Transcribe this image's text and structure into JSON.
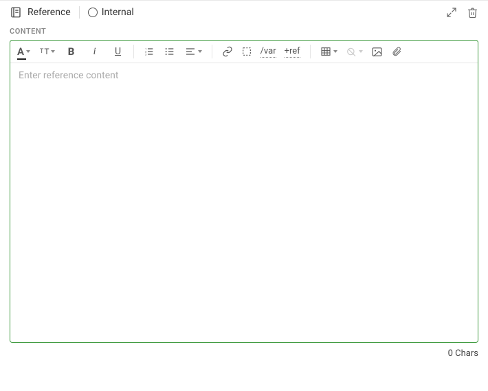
{
  "header": {
    "title": "Reference",
    "internal_label": "Internal"
  },
  "section_label": "CONTENT",
  "toolbar": {
    "var_label": "/var",
    "ref_label": "+ref"
  },
  "editor": {
    "placeholder": "Enter reference content"
  },
  "char_count": "0 Chars"
}
